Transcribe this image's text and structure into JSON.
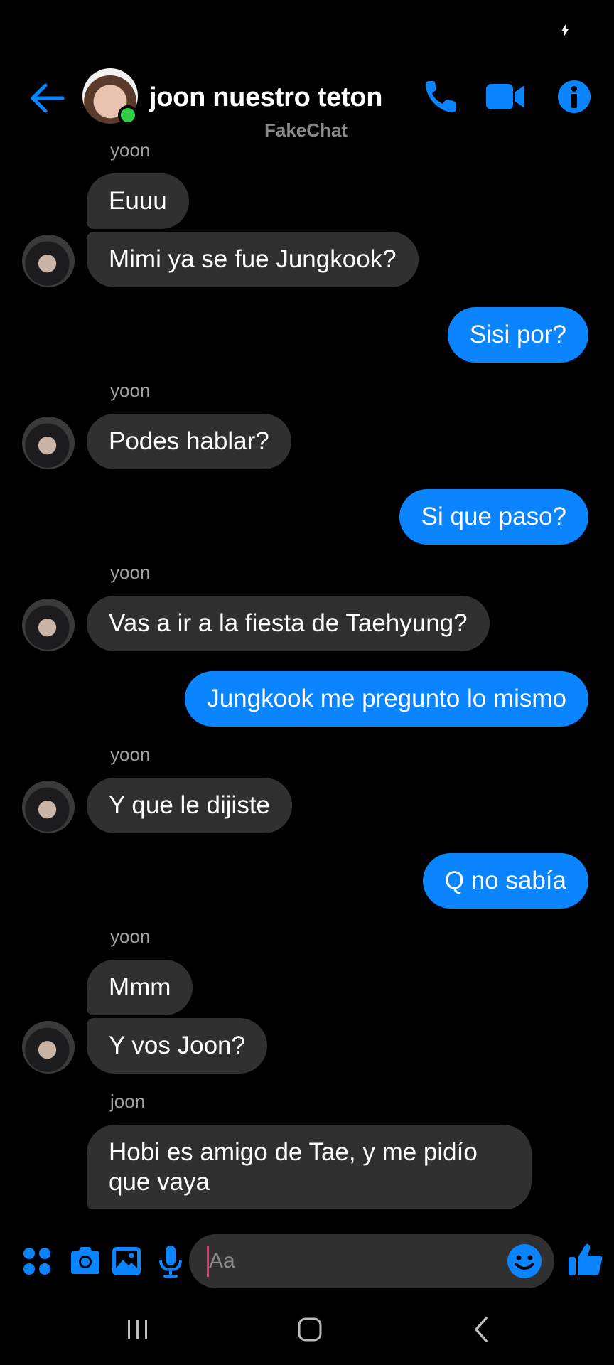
{
  "header": {
    "contact_name": "joon nuestro teton",
    "subtitle": "FakeChat"
  },
  "messages": [
    {
      "label": "yoon"
    },
    {
      "text": "Euuu"
    },
    {
      "text": "Mimi ya se fue Jungkook?"
    },
    {
      "text": "Sisi por?"
    },
    {
      "label": "yoon"
    },
    {
      "text": "Podes hablar?"
    },
    {
      "text": "Si que paso?"
    },
    {
      "label": "yoon"
    },
    {
      "text": "Vas a ir a la fiesta de Taehyung?"
    },
    {
      "text": "Jungkook me pregunto lo mismo"
    },
    {
      "label": "yoon"
    },
    {
      "text": "Y que le dijiste"
    },
    {
      "text": "Q no sabía"
    },
    {
      "label": "yoon"
    },
    {
      "text": "Mmm"
    },
    {
      "text": "Y vos Joon?"
    },
    {
      "label": "joon"
    },
    {
      "text_line1": "Hobi es amigo de Tae, y me pidío",
      "text_line2": "que vaya"
    }
  ],
  "composer": {
    "placeholder": "Aa"
  },
  "colors": {
    "accent": "#0a84ff",
    "incoming_bubble": "#303030",
    "online": "#31cc46",
    "background": "#000000"
  }
}
